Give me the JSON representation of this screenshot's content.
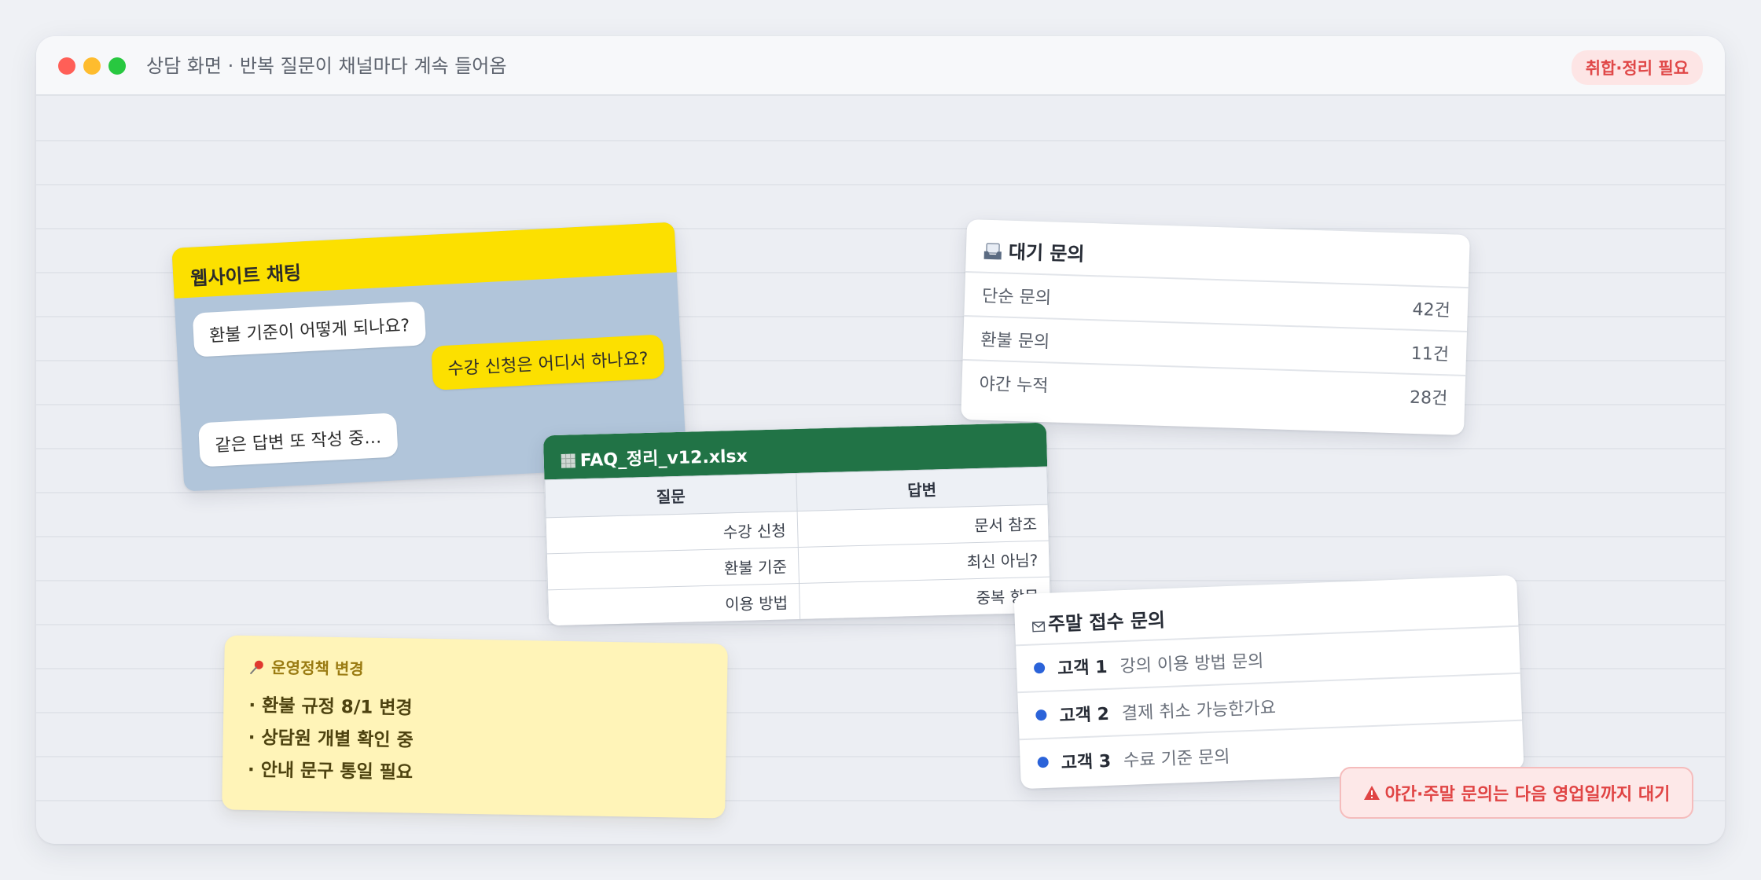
{
  "window": {
    "title": "상담 화면 · 반복 질문이 채널마다 계속 들어옴",
    "badge": "취합·정리 필요"
  },
  "chat": {
    "title": "웹사이트 채팅",
    "messages": [
      {
        "text": "환불 기준이 어떻게 되나요?"
      },
      {
        "text": "수강 신청은 어디서 하나요?"
      },
      {
        "text": "같은 답변 또 작성 중…"
      }
    ]
  },
  "waiting": {
    "icon": "inbox-icon",
    "title": "대기 문의",
    "rows": [
      {
        "label": "단순 문의",
        "count": "42건"
      },
      {
        "label": "환불 문의",
        "count": "11건"
      },
      {
        "label": "야간 누적",
        "count": "28건"
      }
    ]
  },
  "excel": {
    "icon": "spreadsheet-icon",
    "title": "FAQ_정리_v12.xlsx",
    "columns": [
      "질문",
      "답변"
    ],
    "rows": [
      [
        "수강 신청",
        "문서 참조"
      ],
      [
        "환불 기준",
        "최신 아님?"
      ],
      [
        "이용 방법",
        "중복 항목"
      ]
    ]
  },
  "policy": {
    "icon": "pushpin-icon",
    "title": "운영정책 변경",
    "items": [
      "· 환불 규정 8/1 변경",
      "· 상담원 개별 확인 중",
      "· 안내 문구 통일 필요"
    ]
  },
  "weekend": {
    "icon": "envelope-icon",
    "title": "주말 접수 문의",
    "items": [
      {
        "name": "고객 1",
        "message": "강의 이용 방법 문의"
      },
      {
        "name": "고객 2",
        "message": "결제 취소 가능한가요"
      },
      {
        "name": "고객 3",
        "message": "수료 기준 문의"
      }
    ]
  },
  "alert": {
    "icon": "warning-icon",
    "text": "야간·주말 문의는 다음 영업일까지 대기"
  },
  "colors": {
    "kakao_yellow": "#fce000",
    "excel_green": "#217346",
    "alert_red": "#e04444",
    "bullet_blue": "#2b63d9"
  }
}
